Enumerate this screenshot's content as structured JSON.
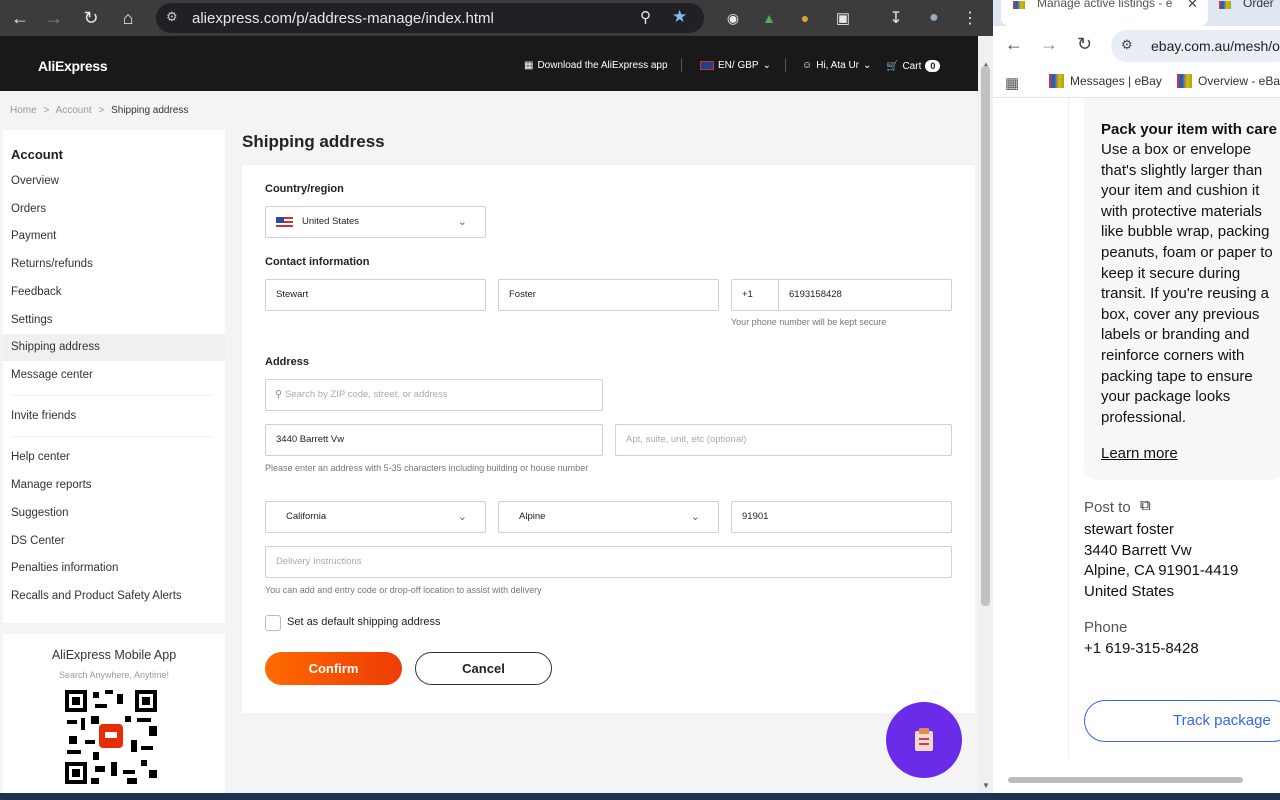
{
  "browser_left": {
    "url": "aliexpress.com/p/address-manage/index.html"
  },
  "header": {
    "logo": "AliExpress",
    "download_app": "Download the AliExpress app",
    "language": "EN/ GBP",
    "greeting": "Hi, Ata Ur",
    "cart_label": "Cart",
    "cart_count": "0"
  },
  "breadcrumb": {
    "home": "Home",
    "account": "Account",
    "current": "Shipping address",
    "sep": ">"
  },
  "sidebar": {
    "title": "Account",
    "items": [
      {
        "label": "Overview"
      },
      {
        "label": "Orders"
      },
      {
        "label": "Payment"
      },
      {
        "label": "Returns/refunds"
      },
      {
        "label": "Feedback"
      },
      {
        "label": "Settings"
      },
      {
        "label": "Shipping address"
      },
      {
        "label": "Message center"
      },
      {
        "label": "Invite friends"
      },
      {
        "label": "Help center"
      },
      {
        "label": "Manage reports"
      },
      {
        "label": "Suggestion"
      },
      {
        "label": "DS Center"
      },
      {
        "label": "Penalties information"
      },
      {
        "label": "Recalls and Product Safety Alerts"
      }
    ],
    "active_index": 6
  },
  "app_promo": {
    "title": "AliExpress Mobile App",
    "subtitle": "Search Anywhere, Anytime!"
  },
  "form": {
    "title": "Shipping address",
    "country_label": "Country/region",
    "country_value": "United States",
    "contact_label": "Contact information",
    "first_name": "Stewart",
    "last_name": "Foster",
    "phone_code": "+1",
    "phone": "6193158428",
    "phone_hint": "Your phone number will be kept secure",
    "address_label": "Address",
    "search_placeholder": "Search by ZIP code, street, or address",
    "street": "3440 Barrett Vw",
    "apt_placeholder": "Apt, suite, unit, etc (optional)",
    "address_hint": "Please enter an address with 5-35 characters including building or house number",
    "state": "California",
    "city": "Alpine",
    "zip": "91901",
    "delivery_placeholder": "Delivery Instructions",
    "delivery_hint": "You can add and entry code or drop-off location to assist with delivery",
    "default_label": "Set as default shipping address",
    "confirm": "Confirm",
    "cancel": "Cancel"
  },
  "browser_right": {
    "tab1": "Manage active listings - e",
    "tab2": "Order",
    "url": "ebay.com.au/mesh/o",
    "bookmark1": "Messages | eBay",
    "bookmark2": "Overview - eBa"
  },
  "ebay_panel": {
    "pack_title": "Pack your item with care",
    "pack_body": "Use a box or envelope that's slightly larger than your item and cushion it with protective materials like bubble wrap, packing peanuts, foam or paper to keep it secure during transit. If you're reusing a box, cover any previous labels or branding and reinforce corners with packing tape to ensure your package looks professional.",
    "learn_more": "Learn more",
    "post_to": "Post to",
    "addr_name": "stewart foster",
    "addr_street": "3440 Barrett Vw",
    "addr_city": "Alpine, CA 91901-4419",
    "addr_country": "United States",
    "phone_label": "Phone",
    "phone_value": "+1 619-315-8428",
    "track": "Track package"
  }
}
